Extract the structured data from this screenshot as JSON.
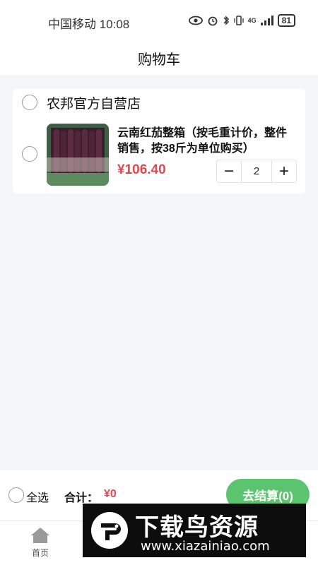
{
  "status_bar": {
    "carrier_time": "中国移动 10:08",
    "network": "4G",
    "battery": "81"
  },
  "header": {
    "title": "购物车"
  },
  "store": {
    "name": "农邦官方自营店",
    "item": {
      "title": "云南红茄整箱（按毛重计价，整件销售，按38斤为单位购买）",
      "price": "¥106.40",
      "quantity": "2",
      "minus": "−",
      "plus": "+"
    }
  },
  "checkout": {
    "select_all": "全选",
    "total_label": "合计：",
    "total_value": "¥0",
    "button": "去结算(0)"
  },
  "tab_bar": {
    "items": [
      {
        "label": "首页",
        "icon": "home-icon"
      }
    ]
  },
  "watermark": {
    "title": "下载鸟资源",
    "url": "www.xiazainiao.com"
  },
  "colors": {
    "accent_green": "#5cc36e",
    "price_red": "#e0474f",
    "background": "#f5f6f8"
  }
}
